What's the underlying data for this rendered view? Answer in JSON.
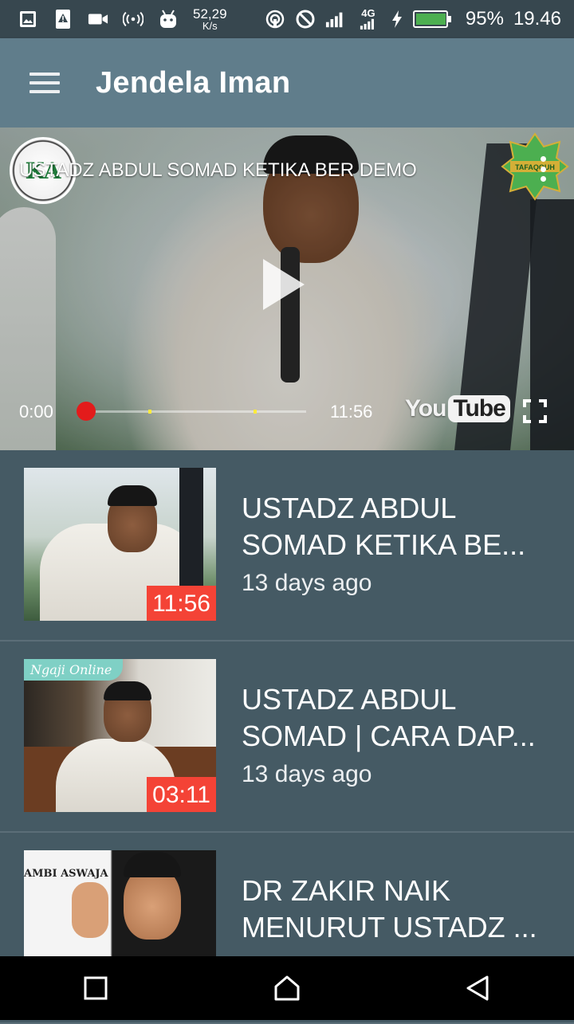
{
  "status_bar": {
    "net_speed_value": "52,29",
    "net_speed_unit": "K/s",
    "signal_type": "4G",
    "battery_percent": "95%",
    "time": "19.46",
    "icons": [
      "image-icon",
      "warning-icon",
      "video-camera-icon",
      "hotspot-icon",
      "android-icon",
      "nfc-icon",
      "block-icon",
      "signal-icon",
      "charging-icon",
      "battery-icon"
    ]
  },
  "toolbar": {
    "title": "Jendela Iman",
    "menu_icon": "hamburger-menu-icon"
  },
  "player": {
    "title": "USTADZ ABDUL SOMAD KETIKA BER DEMO",
    "current_time": "0:00",
    "duration": "11:56",
    "progress": 0,
    "channel_logo_text": "KA",
    "badge_text": "TAFAQQUH",
    "youtube_you": "You",
    "youtube_tube": "Tube"
  },
  "videos": [
    {
      "title_line1": "USTADZ ABDUL",
      "title_line2": "SOMAD KETIKA BE...",
      "date": "13 days ago",
      "duration": "11:56"
    },
    {
      "title_line1": "USTADZ ABDUL",
      "title_line2": "SOMAD | CARA DAP...",
      "date": "13 days ago",
      "duration": "03:11",
      "thumb_tag": "Ngaji Online"
    },
    {
      "title_line1": "DR ZAKIR NAIK",
      "title_line2": "MENURUT USTADZ ...",
      "thumb_caption": "AMBI ASWAJA"
    }
  ],
  "colors": {
    "status_bar": "#37474f",
    "toolbar": "#607d8b",
    "background": "#455a64",
    "duration_badge": "#f44336",
    "seek_thumb": "#e31b1b"
  }
}
